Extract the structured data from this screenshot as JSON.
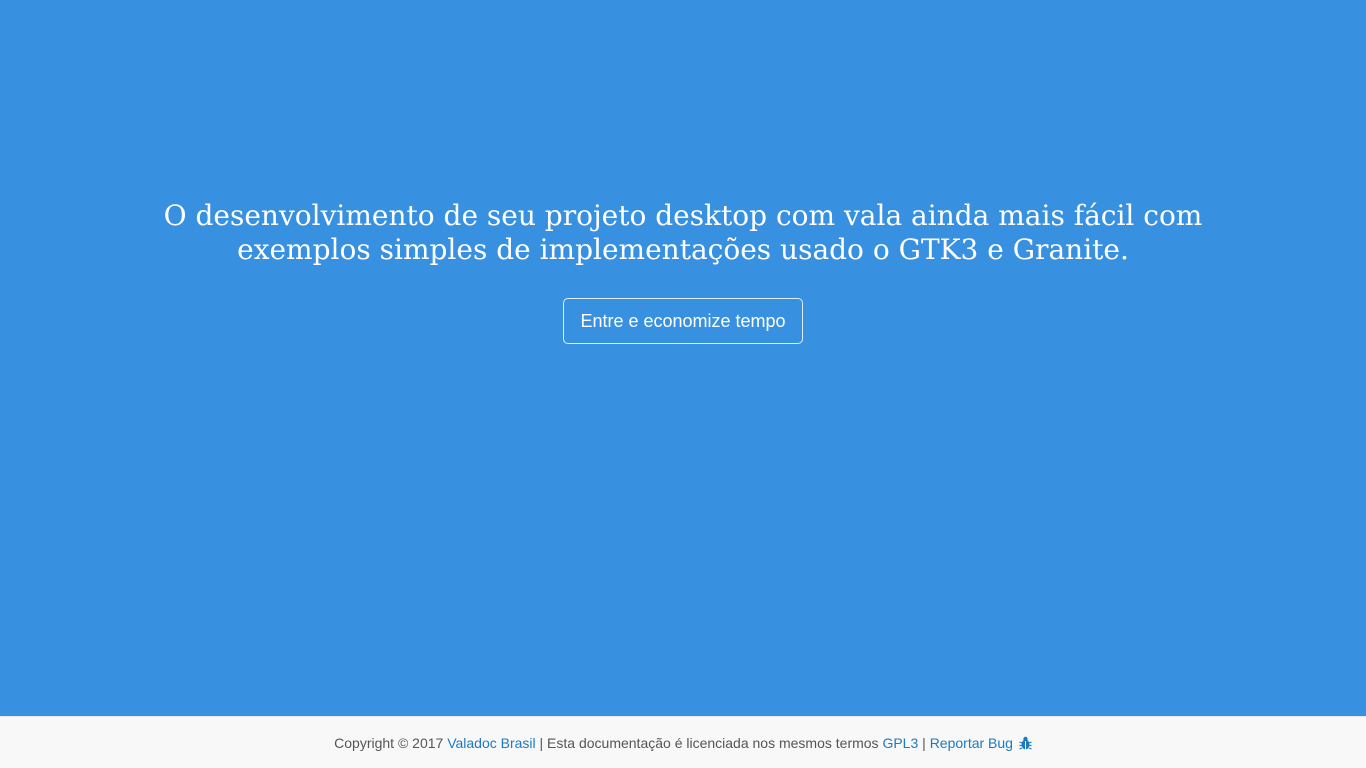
{
  "hero": {
    "line1": "O desenvolvimento de seu projeto desktop com vala ainda mais fácil com",
    "line2": "exemplos simples de implementações usado o GTK3 e Granite.",
    "cta_label": "Entre e economize tempo"
  },
  "footer": {
    "copyright": "Copyright © 2017 ",
    "brand_link": "Valadoc Brasil",
    "sep1": " | Esta documentação é licenciada nos mesmos termos ",
    "license_link": "GPL3",
    "sep2": " | ",
    "bug_link": "Reportar Bug",
    "bug_icon": "bug-icon"
  },
  "colors": {
    "hero_bg": "#3891e0",
    "footer_bg": "#f8f8f8",
    "link": "#1a7bc4"
  }
}
